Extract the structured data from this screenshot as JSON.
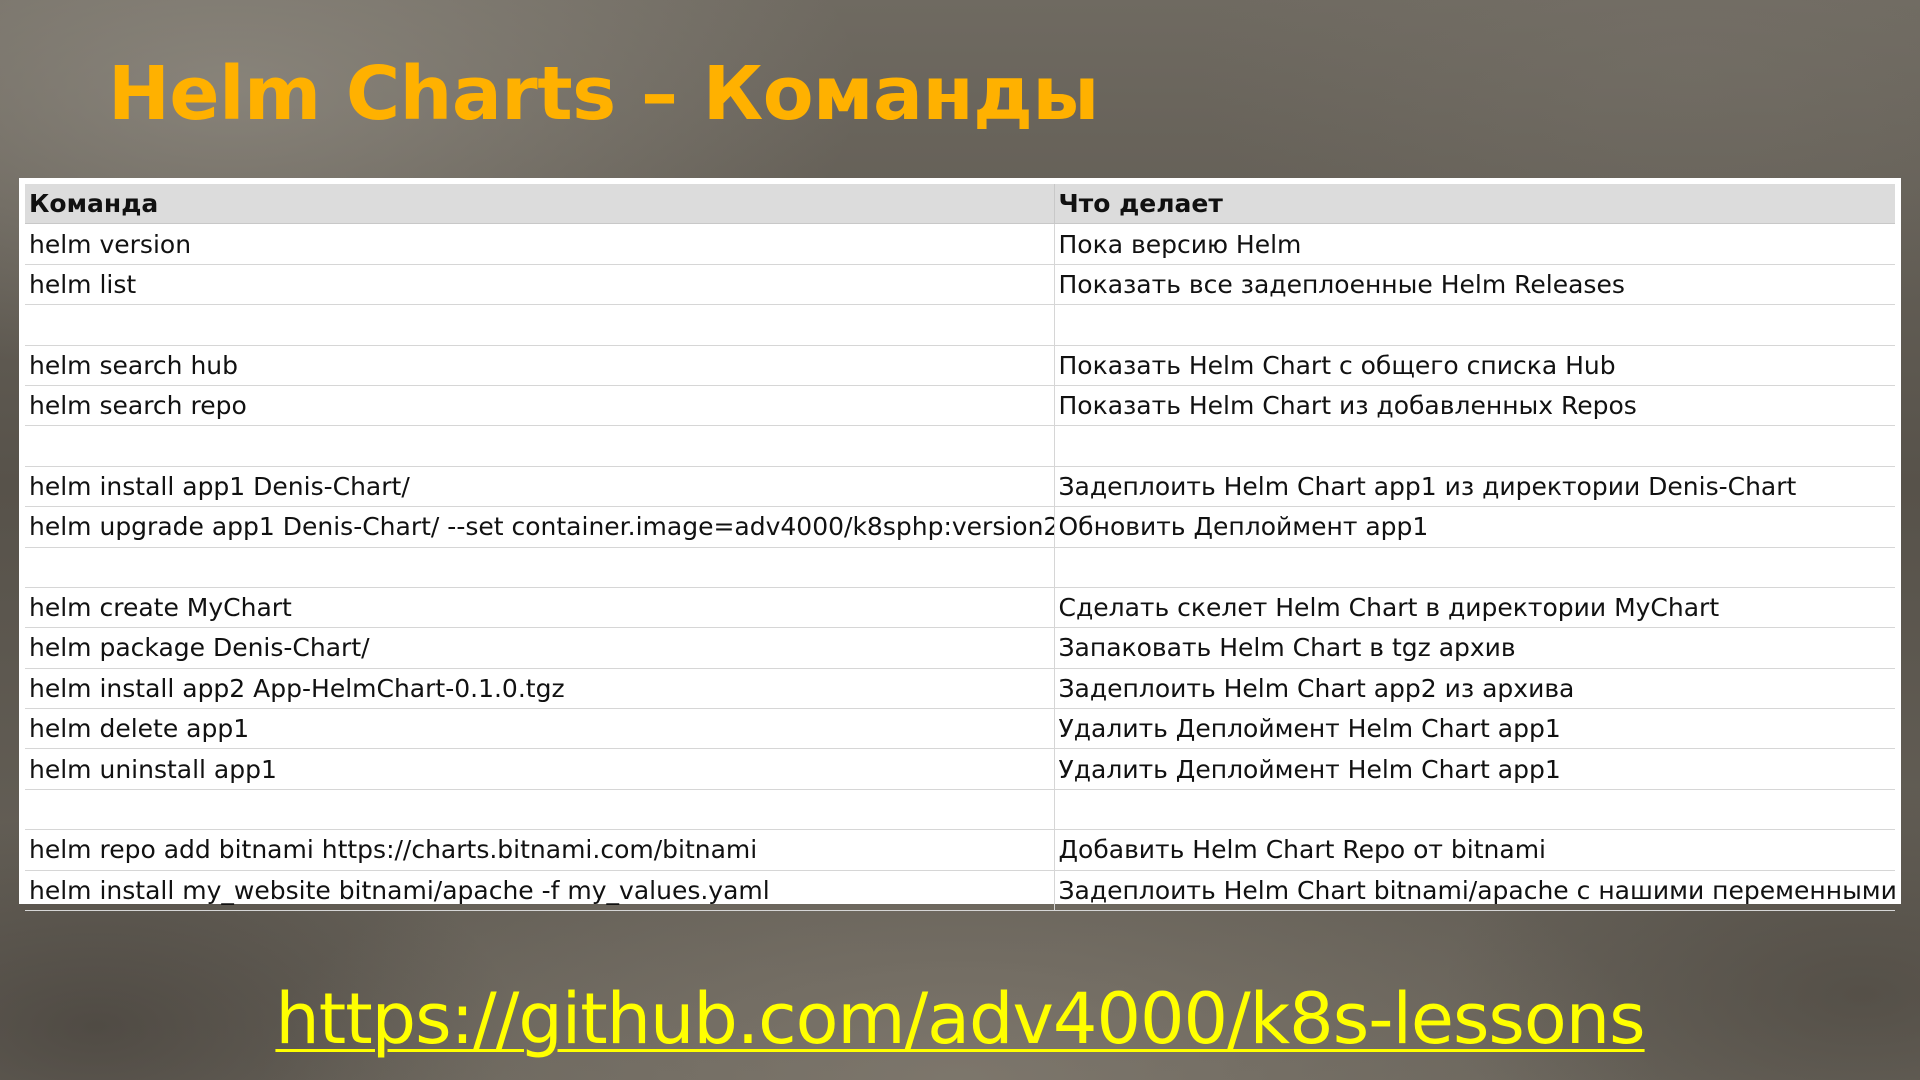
{
  "slide": {
    "title": "Helm Charts – Команды",
    "link": "https://github.com/adv4000/k8s-lessons"
  },
  "colors": {
    "title": "#ffb100",
    "link": "#ffff00",
    "header_bg": "#dcdcdc"
  },
  "table": {
    "headers": {
      "command": "Команда",
      "description": "Что делает"
    },
    "rows": [
      {
        "command": "helm version",
        "description": "Пока версию Helm"
      },
      {
        "command": "helm list",
        "description": "Показать все задеплоенные Helm Releases"
      },
      {
        "command": "",
        "description": ""
      },
      {
        "command": "helm search hub",
        "description": "Показать Helm Chart с общего списка Hub"
      },
      {
        "command": "helm search repo",
        "description": "Показать Helm Chart из добавленных Repos"
      },
      {
        "command": "",
        "description": ""
      },
      {
        "command": "helm install app1 Denis-Chart/",
        "description": "Задеплоить Helm Chart app1 из директории Denis-Chart"
      },
      {
        "command": "helm upgrade app1 Denis-Chart/ --set container.image=adv4000/k8sphp:version2",
        "description": "Обновить Деплоймент app1"
      },
      {
        "command": "",
        "description": ""
      },
      {
        "command": "helm create MyChart",
        "description": "Сделать скелет Helm Chart в директории MyChart"
      },
      {
        "command": "helm package Denis-Chart/",
        "description": "Запаковать Helm Chart в tgz архив"
      },
      {
        "command": "helm install app2 App-HelmChart-0.1.0.tgz",
        "description": "Задеплоить Helm Chart app2 из архива"
      },
      {
        "command": "helm delete app1",
        "description": "Удалить Деплоймент Helm Chart app1"
      },
      {
        "command": "helm uninstall app1",
        "description": "Удалить Деплоймент Helm Chart app1"
      },
      {
        "command": "",
        "description": ""
      },
      {
        "command": "helm repo add bitnami https://charts.bitnami.com/bitnami",
        "description": "Добавить Helm Chart Repo от bitnami"
      },
      {
        "command": "helm install my_website bitnami/apache -f my_values.yaml",
        "description": "Задеплоить Helm Chart bitnami/apache с нашими переменными"
      }
    ]
  }
}
